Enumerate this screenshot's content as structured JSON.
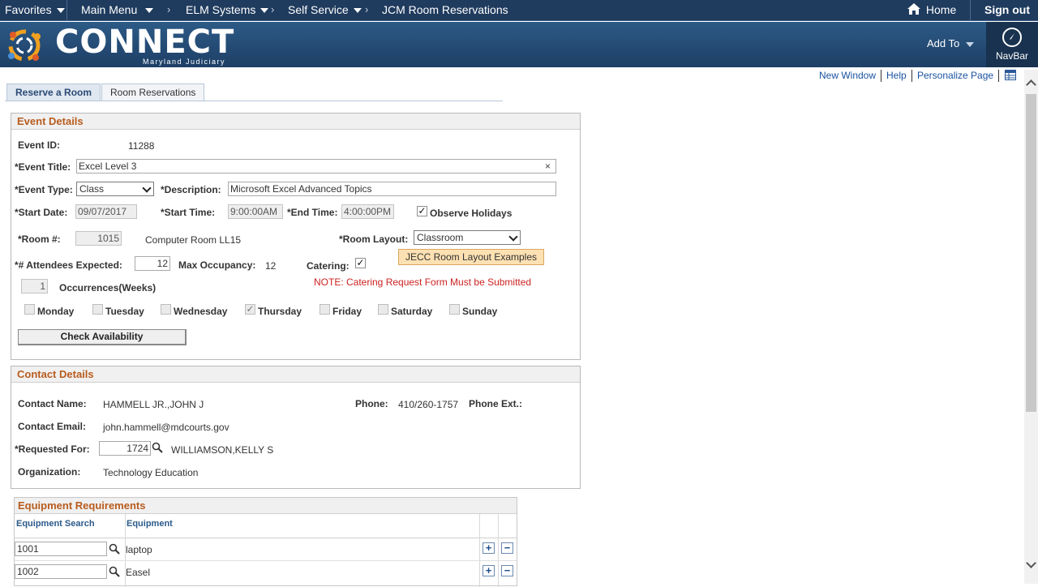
{
  "nav": {
    "favorites": "Favorites",
    "main_menu": "Main Menu",
    "breadcrumb_1": "ELM Systems",
    "breadcrumb_2": "Self Service",
    "breadcrumb_3": "JCM Room Reservations",
    "home": "Home",
    "sign_out": "Sign out"
  },
  "banner": {
    "brand": "CONNECT",
    "sub": "Maryland Judiciary",
    "add_to": "Add To",
    "navbar": "NavBar"
  },
  "page_links": {
    "new_window": "New Window",
    "help": "Help",
    "personalize": "Personalize Page"
  },
  "tabs": [
    "Reserve a Room",
    "Room Reservations"
  ],
  "event": {
    "header": "Event Details",
    "event_id_label": "Event ID:",
    "event_id": "11288",
    "title_label": "*Event Title:",
    "title_value": "Excel Level 3",
    "type_label": "*Event Type:",
    "type_value": "Class",
    "description_label": "*Description:",
    "description_value": "Microsoft Excel Advanced Topics",
    "start_date_label": "*Start Date:",
    "start_date": "09/07/2017",
    "start_time_label": "*Start Time:",
    "start_time": "9:00:00AM",
    "end_time_label": "*End Time:",
    "end_time": "4:00:00PM",
    "observe_holidays_label": "Observe Holidays",
    "room_label": "*Room #:",
    "room_value": "1015",
    "room_name": "Computer Room LL15",
    "room_layout_label": "*Room Layout:",
    "room_layout_value": "Classroom",
    "attendees_label": "*# Attendees Expected:",
    "attendees_value": "12",
    "max_occupancy_label": "Max Occupancy:",
    "max_occupancy_value": "12",
    "catering_label": "Catering:",
    "layout_examples_button": "JECC Room Layout Examples",
    "occurrences_value": "1",
    "occurrences_label": "Occurrences(Weeks)",
    "catering_note": "NOTE: Catering Request Form Must be Submitted",
    "days": [
      "Monday",
      "Tuesday",
      "Wednesday",
      "Thursday",
      "Friday",
      "Saturday",
      "Sunday"
    ],
    "check_button": "Check Availability"
  },
  "contact": {
    "header": "Contact Details",
    "name_label": "Contact Name:",
    "name_value": "HAMMELL JR.,JOHN J",
    "phone_label": "Phone:",
    "phone_value": "410/260-1757",
    "phone_ext_label": "Phone Ext.:",
    "email_label": "Contact Email:",
    "email_value": "john.hammell@mdcourts.gov",
    "requested_label": "*Requested For:",
    "requested_value": "1724",
    "requested_name": "WILLIAMSON,KELLY S",
    "org_label": "Organization:",
    "org_value": "Technology Education"
  },
  "equipment": {
    "header": "Equipment Requirements",
    "col_search": "Equipment Search",
    "col_equipment": "Equipment",
    "rows": [
      {
        "code": "1001",
        "name": "laptop"
      },
      {
        "code": "1002",
        "name": "Easel"
      }
    ]
  },
  "colors": {
    "nav_bg": "#1f3b5e",
    "section_header": "#b85c1e",
    "link": "#1a52a0",
    "note": "#cc2222"
  }
}
